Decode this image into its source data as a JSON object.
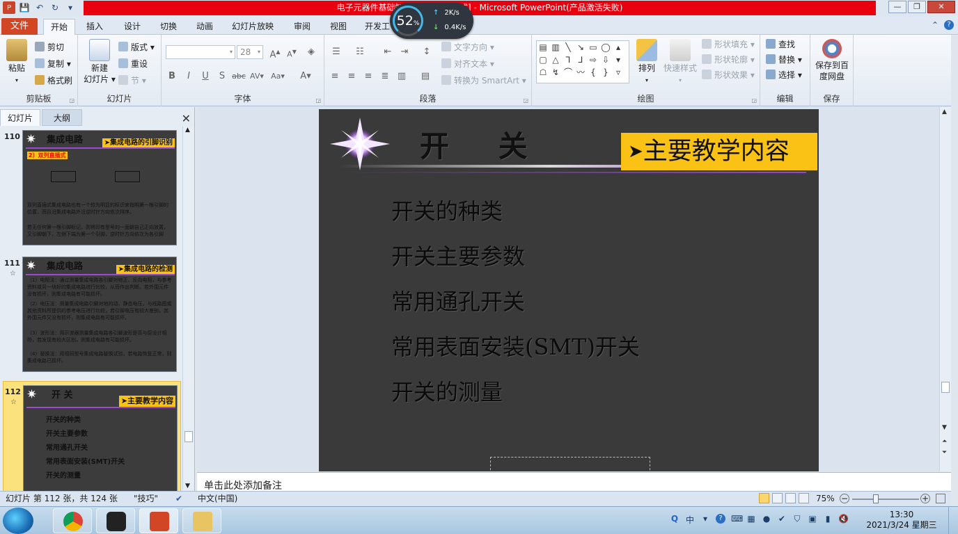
{
  "window": {
    "title": "电子元器件基础知识大全 [兼容模式] - Microsoft PowerPoint(产品激活失败)",
    "minimize": "—",
    "maximize": "❐",
    "close": "✕"
  },
  "net_meter": {
    "percent": "52",
    "percent_unit": "%",
    "up": "2K/s",
    "down": "0.4K/s"
  },
  "tabs": {
    "file": "文件",
    "items": [
      "开始",
      "插入",
      "设计",
      "切换",
      "动画",
      "幻灯片放映",
      "审阅",
      "视图",
      "开发工"
    ],
    "active": "开始"
  },
  "ribbon": {
    "clipboard": {
      "label": "剪贴板",
      "paste": "粘贴",
      "cut": "剪切",
      "copy": "复制",
      "format_painter": "格式刷"
    },
    "slides": {
      "label": "幻灯片",
      "new_slide_1": "新建",
      "new_slide_2": "幻灯片",
      "layout": "版式",
      "reset": "重设",
      "section": "节"
    },
    "font": {
      "label": "字体",
      "font_name": "",
      "font_size": "28",
      "bold": "B",
      "italic": "I",
      "underline": "U",
      "shadow": "S",
      "strike": "abc",
      "spacing": "AV",
      "case": "Aa",
      "color": "A",
      "grow": "A",
      "shrink": "A"
    },
    "paragraph": {
      "label": "段落",
      "text_direction": "文字方向",
      "align_text": "对齐文本",
      "smartart": "转换为 SmartArt"
    },
    "drawing": {
      "label": "绘图",
      "arrange": "排列",
      "quick_styles": "快速样式",
      "shape_fill": "形状填充",
      "shape_outline": "形状轮廓",
      "shape_effects": "形状效果"
    },
    "editing": {
      "label": "编辑",
      "find": "查找",
      "replace": "替换",
      "select": "选择"
    },
    "save": {
      "label": "保存",
      "save_to_cloud_1": "保存到百",
      "save_to_cloud_2": "度网盘"
    }
  },
  "left_panel": {
    "tab_slides": "幻灯片",
    "tab_outline": "大纲",
    "close": "✕",
    "thumbnails": [
      {
        "number": "110",
        "title": "集成电路",
        "badge": "集成电路的引脚识别",
        "subhead": "2）双列直插式",
        "body": [
          "双列直插式集成电路也有一个较为明显的标识来指明第一根引脚的位置，而且沿集成电路外沿逆时针方向依次排序。",
          "若无任何第一根引脚标记，则将印有型号的一面朝自己正向放置，又引脚朝下，左侧下端为第一个引脚，逆时针方向依次为各引脚"
        ]
      },
      {
        "number": "111",
        "title": "集成电路",
        "badge": "集成电路的检测",
        "body": [
          "（1）电阻法：通过测量集成电路各引脚对地正、反向电阻，与参考资料或另一块好的集成电路进行比较，从而作出判断。若外围元件没有损坏，则集成电路有可能损坏。",
          "（2）电压法：测量集成电路引脚对地的动、静态电压，与线路图或其他资料所提供的参考电压进行比较，若引脚电压有较大差别，其外围元件又没有损坏，则集成电路有可能损坏。",
          "（3）波形法：用示波器测量集成电路各引脚波形是否与原设计相符，若发现有较大区别，则集成电路有可能损坏。",
          "（4）替换法：用相同型号集成电路替换试验，若电路恢复正常，则集成电路已损坏。"
        ]
      },
      {
        "number": "112",
        "title": "开 关",
        "badge": "主要教学内容",
        "items": [
          "开关的种类",
          "开关主要参数",
          "常用通孔开关",
          "常用表面安装(SMT)开关",
          "开关的测量"
        ]
      }
    ]
  },
  "slide": {
    "title": "开 关",
    "badge": "主要教学内容",
    "items": [
      "开关的种类",
      "开关主要参数",
      "常用通孔开关",
      "常用表面安装(SMT)开关",
      "开关的测量"
    ]
  },
  "notes": {
    "placeholder": "单击此处添加备注"
  },
  "status": {
    "slide_info": "幻灯片 第 112 张，共 124 张",
    "theme": "\"技巧\"",
    "language": "中文(中国)",
    "zoom": "75%"
  },
  "taskbar": {
    "tray_ime": "中",
    "time": "13:30",
    "date": "2021/3/24 星期三"
  },
  "colors": {
    "accent": "#fbc216",
    "title_bar": "#e8000f",
    "file_tab": "#d24625",
    "slide_bg": "#3a3a3a"
  }
}
